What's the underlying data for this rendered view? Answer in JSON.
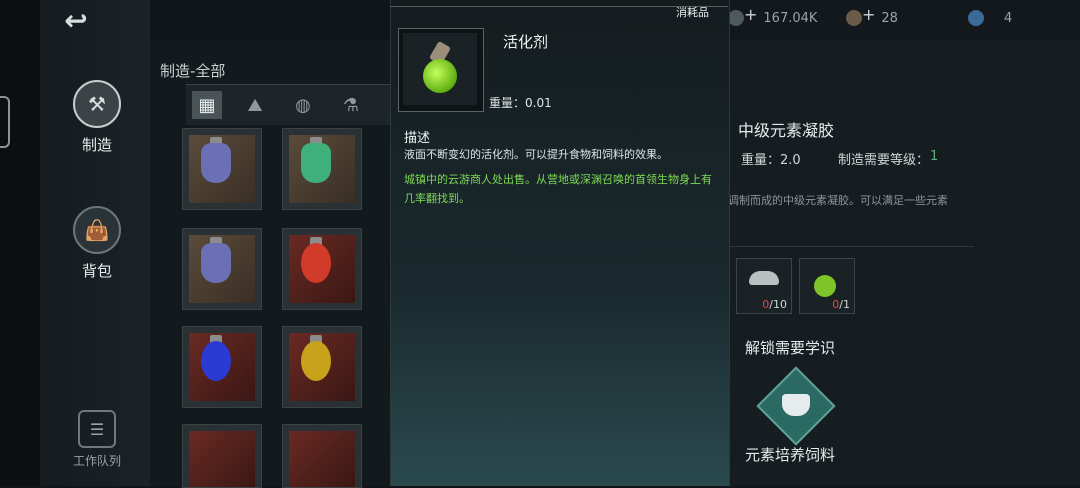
{
  "left_nav": {
    "items": [
      {
        "label": "制造"
      },
      {
        "label": "背包"
      },
      {
        "label": "工作队列"
      }
    ]
  },
  "craft_section": {
    "title": "制造-全部"
  },
  "popup": {
    "tag": "消耗品",
    "item_name": "活化剂",
    "weight": "重量：0.01",
    "description_heading": "描述",
    "description": "液面不断变幻的活化剂。可以提升食物和饲料的效果。",
    "source": "城镇中的云游商人处出售。从营地或深渊召唤的首领生物身上有几率翻找到。"
  },
  "topbar": {
    "currency_1": "167.04K",
    "currency_2": "28",
    "currency_3": "4"
  },
  "recipe": {
    "title": "中级元素凝胶",
    "weight": "重量：2.0",
    "level_label": "制造需要等级：",
    "level_value": "1",
    "description_fragment": "调制而成的中级元素凝胶。可以满足一些元素",
    "materials": [
      {
        "have": "0",
        "need": "/10"
      },
      {
        "have": "0",
        "need": "/1"
      }
    ],
    "unlock_heading": "解锁需要学识",
    "unlock_item": "元素培养饲料"
  },
  "colors": {
    "green_text": "#7ed957",
    "level_green": "#5fb07a",
    "missing_red": "#e04a3a"
  }
}
